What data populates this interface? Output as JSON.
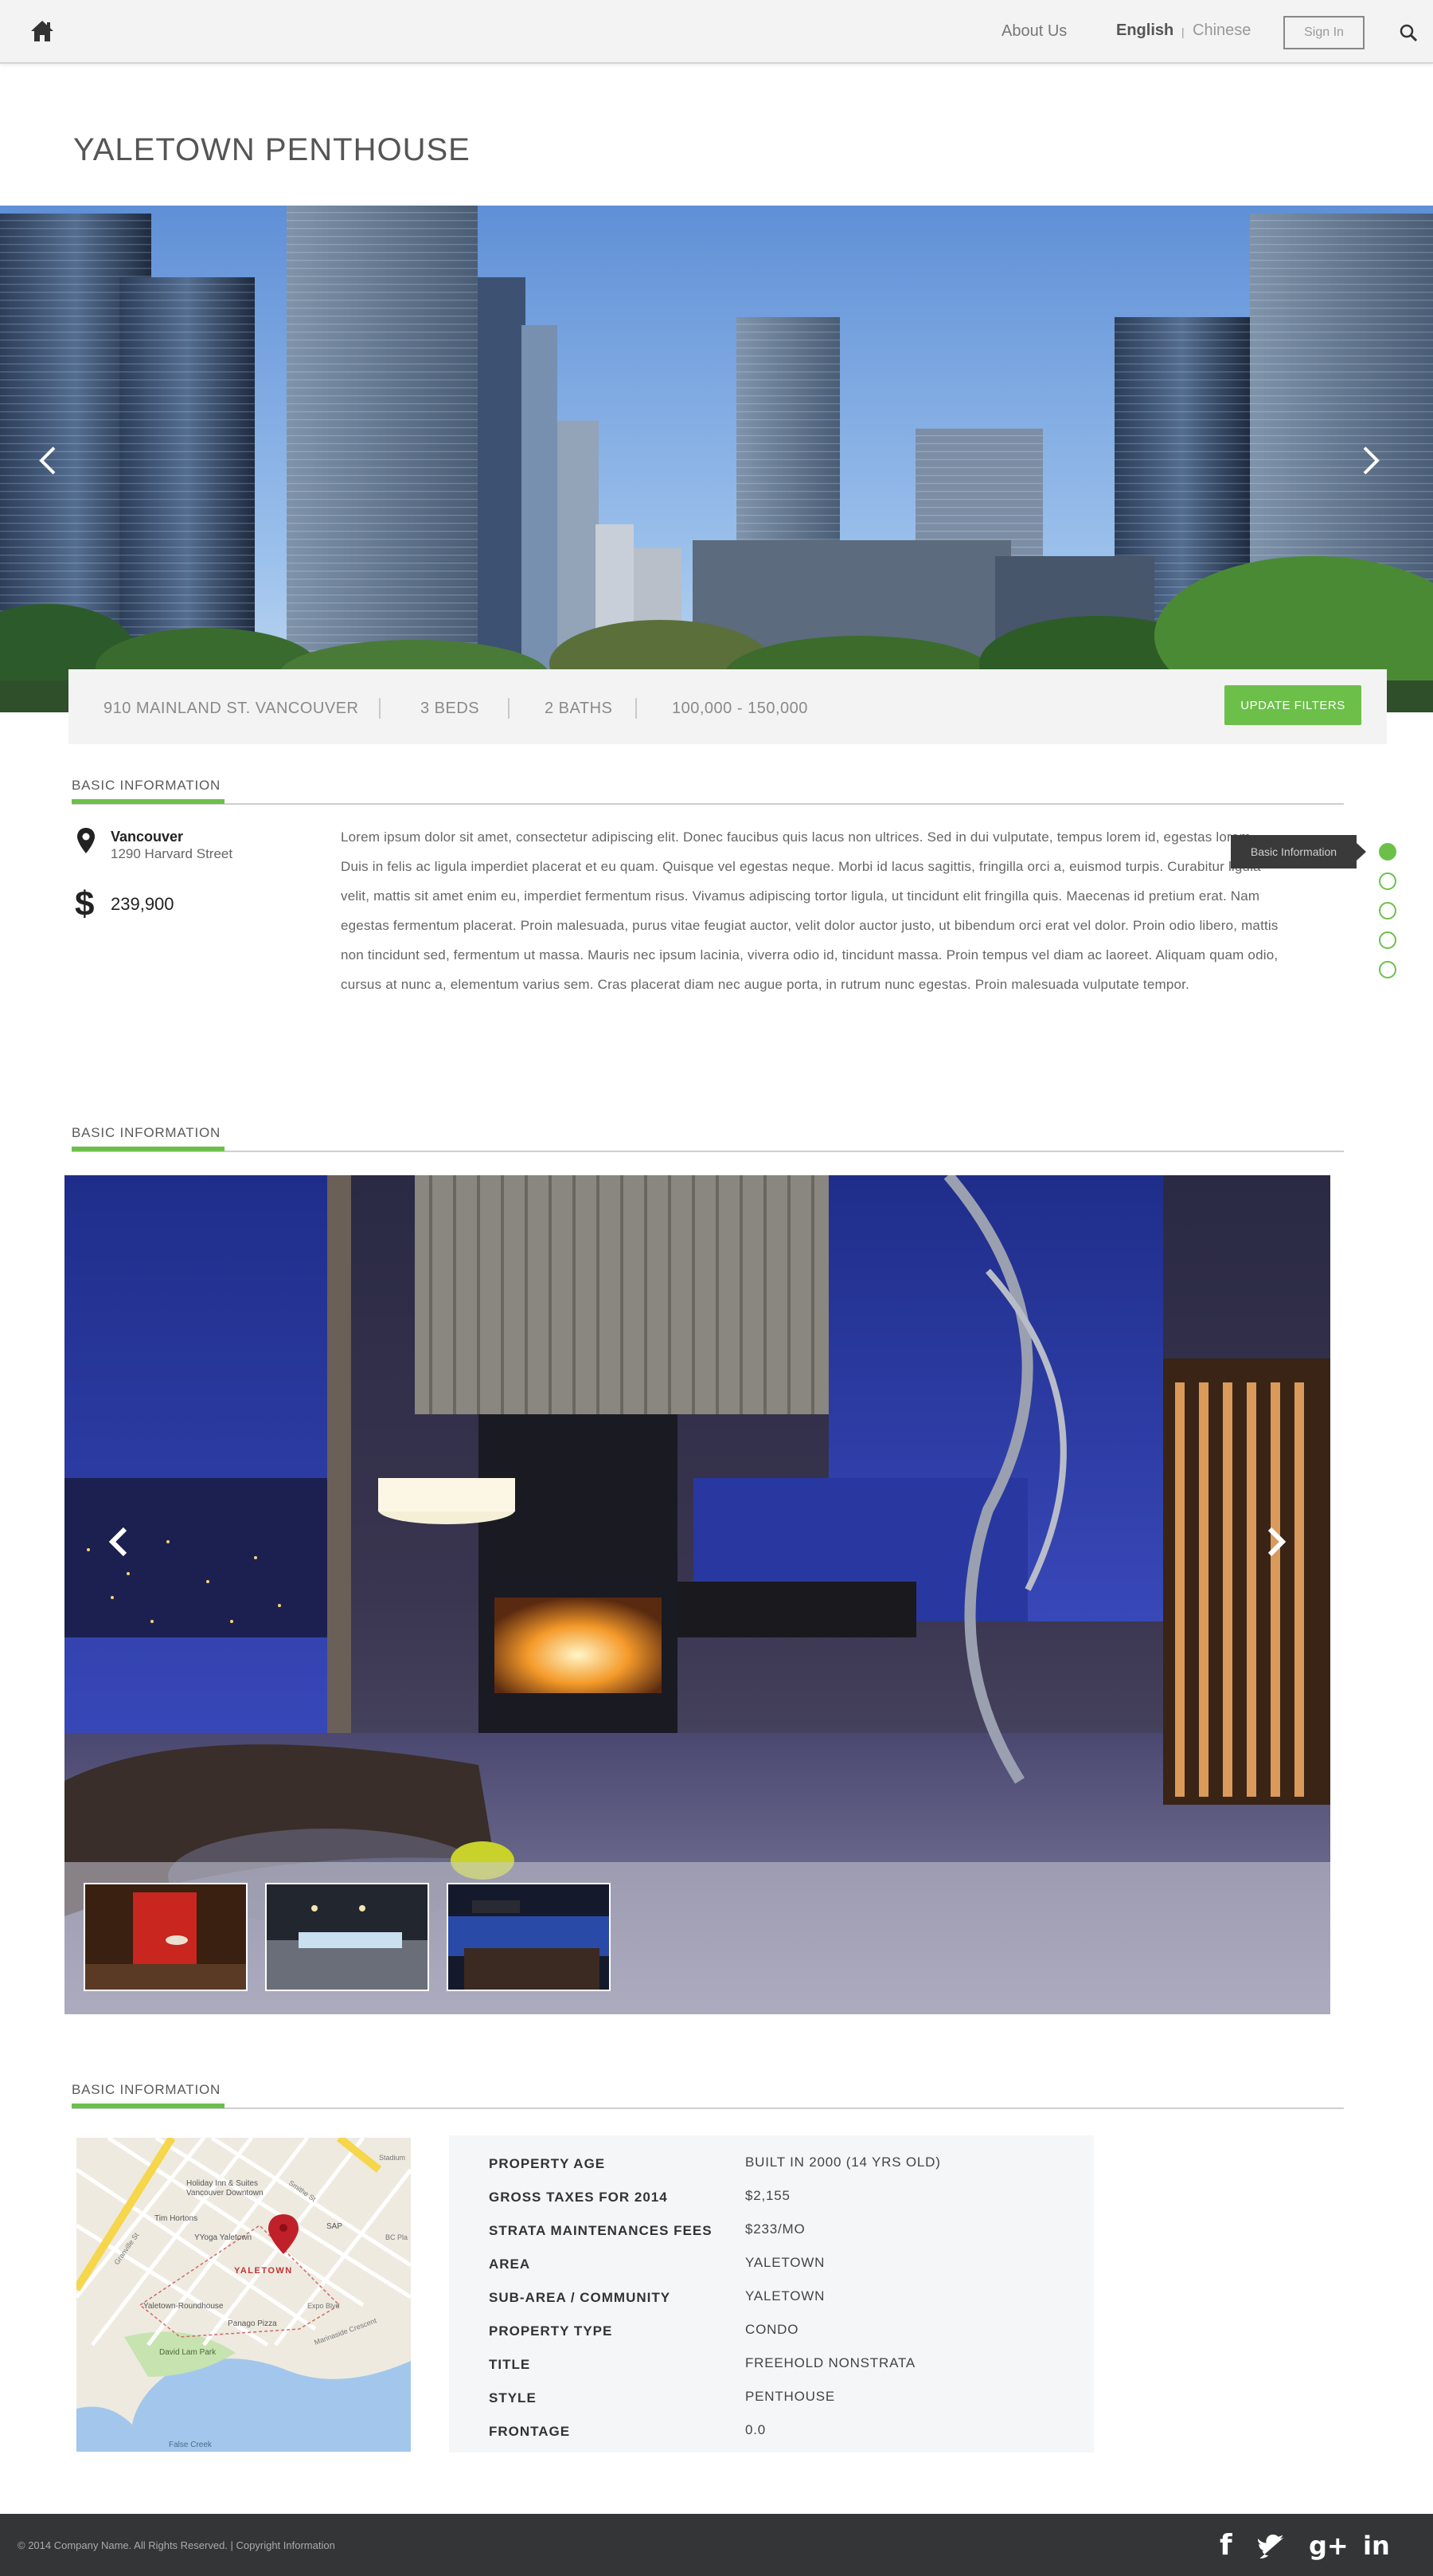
{
  "nav": {
    "home_icon": "home-icon",
    "about_label": "About Us",
    "lang_english": "English",
    "lang_separator": "|",
    "lang_chinese": "Chinese",
    "signin_label": "Sign In",
    "search_icon": "search-icon"
  },
  "page_title": "YALETOWN PENTHOUSE",
  "filters": {
    "address": "910 MAINLAND ST. VANCOUVER",
    "beds": "3 BEDS",
    "baths": "2 BATHS",
    "price_range": "100,000 - 150,000",
    "update_label": "UPDATE FILTERS"
  },
  "basic_info": {
    "heading": "BASIC INFORMATION",
    "city": "Vancouver",
    "street": "1290 Harvard Street",
    "price": "239,900",
    "description": "Lorem ipsum dolor sit amet, consectetur adipiscing elit. Donec faucibus quis lacus non ultrices. Sed in dui vulputate, tempus lorem id, egestas lorem. Duis in felis ac ligula imperdiet placerat et eu quam. Quisque vel egestas neque. Morbi id lacus sagittis, fringilla orci a, euismod turpis. Curabitur ligula velit, mattis sit amet enim eu, imperdiet fermentum risus. Vivamus adipiscing tortor ligula, ut tincidunt elit fringilla quis. Maecenas id pretium erat. Nam egestas fermentum placerat. Proin malesuada, purus vitae feugiat auctor, velit dolor auctor justo, ut bibendum orci erat vel dolor. Proin odio libero, mattis non tincidunt sed, fermentum ut massa. Mauris nec ipsum lacinia, viverra odio id, tincidunt massa. Proin tempus vel diam ac laoreet. Aliquam quam odio, cursus at nunc a, elementum varius sem. Cras placerat diam nec augue porta, in rutrum nunc egestas. Proin malesuada vulputate tempor.",
    "tooltip": "Basic Information"
  },
  "gallery_section": {
    "heading": "BASIC INFORMATION"
  },
  "details_section": {
    "heading": "BASIC INFORMATION",
    "rows": [
      {
        "label": "PROPERTY AGE",
        "value": "BUILT IN 2000 (14 YRS OLD)"
      },
      {
        "label": "GROSS TAXES FOR 2014",
        "value": "$2,155"
      },
      {
        "label": "STRATA MAINTENANCES FEES",
        "value": "$233/MO"
      },
      {
        "label": "AREA",
        "value": "YALETOWN"
      },
      {
        "label": "SUB-AREA / COMMUNITY",
        "value": "YALETOWN"
      },
      {
        "label": "PROPERTY TYPE",
        "value": "CONDO"
      },
      {
        "label": "TITLE",
        "value": "FREEHOLD NONSTRATA"
      },
      {
        "label": "STYLE",
        "value": "PENTHOUSE"
      },
      {
        "label": "FRONTAGE",
        "value": "0.0"
      }
    ]
  },
  "map": {
    "labels": {
      "holiday_inn": "Holiday Inn & Suites",
      "holiday_inn2": "Vancouver Downtown",
      "tim_hortons": "Tim Hortons",
      "yoga": "YYoga Yaletown",
      "sap": "SAP",
      "yaletown": "YALETOWN",
      "roundhouse": "Yaletown-Roundhouse",
      "panago": "Panago Pizza",
      "david_lam": "David Lam Park",
      "false_creek": "False Creek",
      "granville": "Granville St",
      "smithe": "Smithe St",
      "stadium": "Stadium",
      "bc_place": "BC Pla",
      "expo": "Expo Blvd",
      "marinaside": "Marinaside Crescent"
    }
  },
  "footer": {
    "copyright": "© 2014 Company Name. All Rights Reserved.  |  Copyright Information",
    "facebook": "f",
    "twitter": "t",
    "gplus": "g+",
    "linkedin": "in"
  },
  "colors": {
    "accent": "#6cc04a",
    "footer": "#333536",
    "tooltip": "#3a3a3a"
  }
}
